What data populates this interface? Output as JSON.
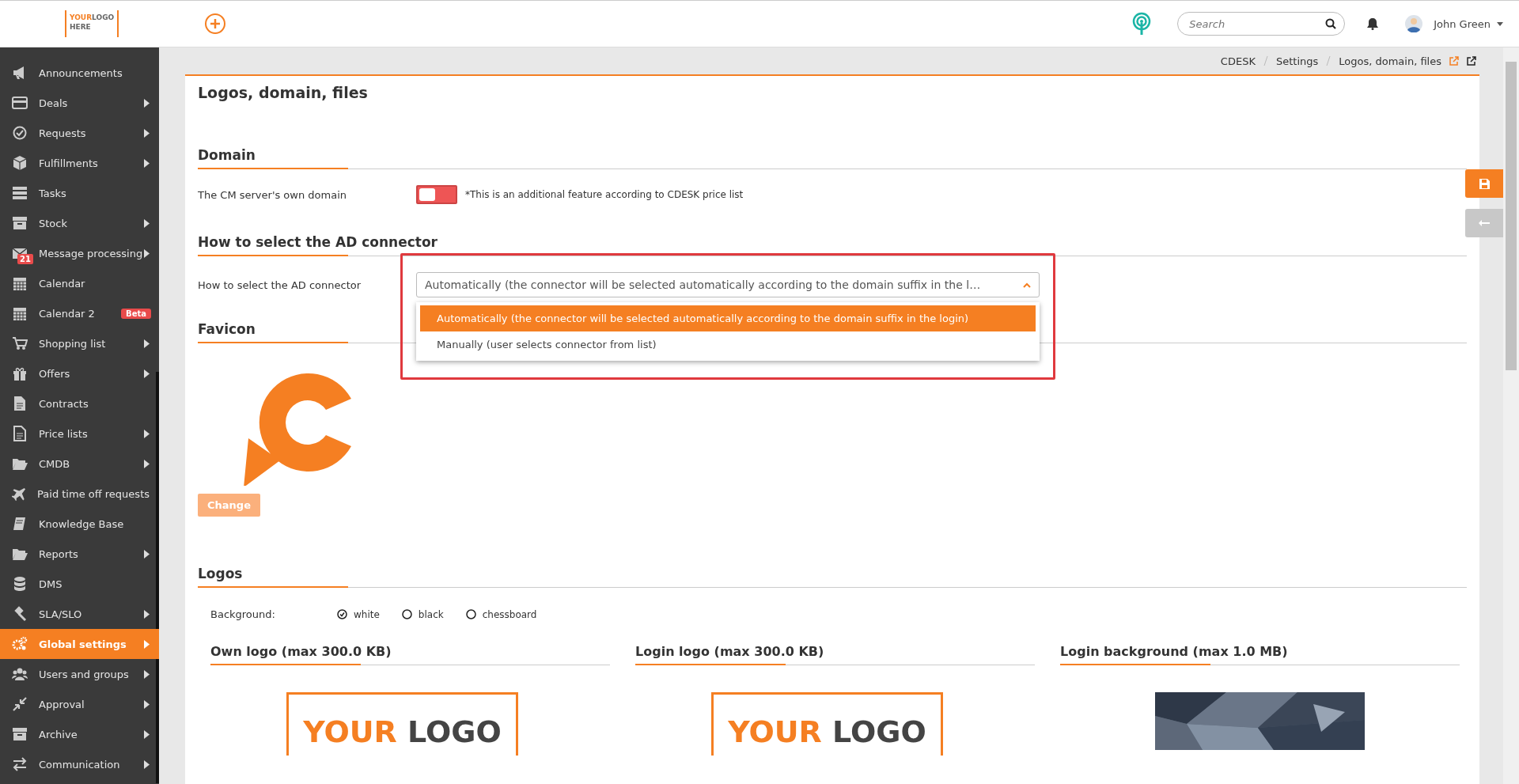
{
  "header": {
    "logo": {
      "words": [
        "YOUR",
        "LOGO"
      ],
      "subtitle": "HERE"
    },
    "search": {
      "placeholder": "Search"
    },
    "user": {
      "name": "John Green"
    }
  },
  "sidebar": {
    "items": [
      {
        "label": "Announcements",
        "submenu": false,
        "selected": false
      },
      {
        "label": "Deals",
        "submenu": true,
        "selected": false
      },
      {
        "label": "Requests",
        "submenu": true,
        "selected": false
      },
      {
        "label": "Fulfillments",
        "submenu": true,
        "selected": false
      },
      {
        "label": "Tasks",
        "submenu": false,
        "selected": false
      },
      {
        "label": "Stock",
        "submenu": true,
        "selected": false
      },
      {
        "label": "Message processing",
        "submenu": true,
        "selected": false,
        "count": "21"
      },
      {
        "label": "Calendar",
        "submenu": false,
        "selected": false
      },
      {
        "label": "Calendar 2",
        "submenu": false,
        "selected": false,
        "tag": "Beta"
      },
      {
        "label": "Shopping list",
        "submenu": true,
        "selected": false
      },
      {
        "label": "Offers",
        "submenu": true,
        "selected": false
      },
      {
        "label": "Contracts",
        "submenu": false,
        "selected": false
      },
      {
        "label": "Price lists",
        "submenu": true,
        "selected": false
      },
      {
        "label": "CMDB",
        "submenu": true,
        "selected": false
      },
      {
        "label": "Paid time off requests",
        "submenu": false,
        "selected": false
      },
      {
        "label": "Knowledge Base",
        "submenu": false,
        "selected": false
      },
      {
        "label": "Reports",
        "submenu": true,
        "selected": false
      },
      {
        "label": "DMS",
        "submenu": false,
        "selected": false
      },
      {
        "label": "SLA/SLO",
        "submenu": true,
        "selected": false
      },
      {
        "label": "Global settings",
        "submenu": true,
        "selected": true
      },
      {
        "label": "Users and groups",
        "submenu": true,
        "selected": false
      },
      {
        "label": "Approval",
        "submenu": true,
        "selected": false
      },
      {
        "label": "Archive",
        "submenu": true,
        "selected": false
      },
      {
        "label": "Communication",
        "submenu": true,
        "selected": false
      }
    ]
  },
  "breadcrumb": [
    "CDESK",
    "Settings",
    "Logos, domain, files"
  ],
  "page": {
    "title": "Logos, domain, files",
    "domain": {
      "heading": "Domain",
      "label": "The CM server's own domain",
      "on": false,
      "note": "*This is an additional feature according to CDESK price list"
    },
    "connector": {
      "heading": "How to select the AD connector",
      "label": "How to select the AD connector",
      "value": "Automatically (the connector will be selected automatically according to the domain suffix in the l…",
      "expanded": true,
      "options": [
        {
          "label": "Automatically (the connector will be selected automatically according to the domain suffix in the login)",
          "selected": true
        },
        {
          "label": "Manually (user selects connector from list)",
          "selected": false
        }
      ]
    },
    "favicon": {
      "heading": "Favicon",
      "button": "Change",
      "disabled": true
    },
    "logos": {
      "heading": "Logos",
      "background_label": "Background:",
      "backgrounds": [
        {
          "label": "white",
          "selected": true
        },
        {
          "label": "black",
          "selected": false
        },
        {
          "label": "chessboard",
          "selected": false
        }
      ],
      "columns": [
        {
          "title": "Own logo (max 300.0 KB)",
          "kind": "logo",
          "words": [
            "YOUR",
            "LOGO"
          ]
        },
        {
          "title": "Login logo (max 300.0 KB)",
          "kind": "logo",
          "words": [
            "YOUR",
            "LOGO"
          ]
        },
        {
          "title": "Login background (max 1.0 MB)",
          "kind": "picture"
        }
      ]
    }
  }
}
